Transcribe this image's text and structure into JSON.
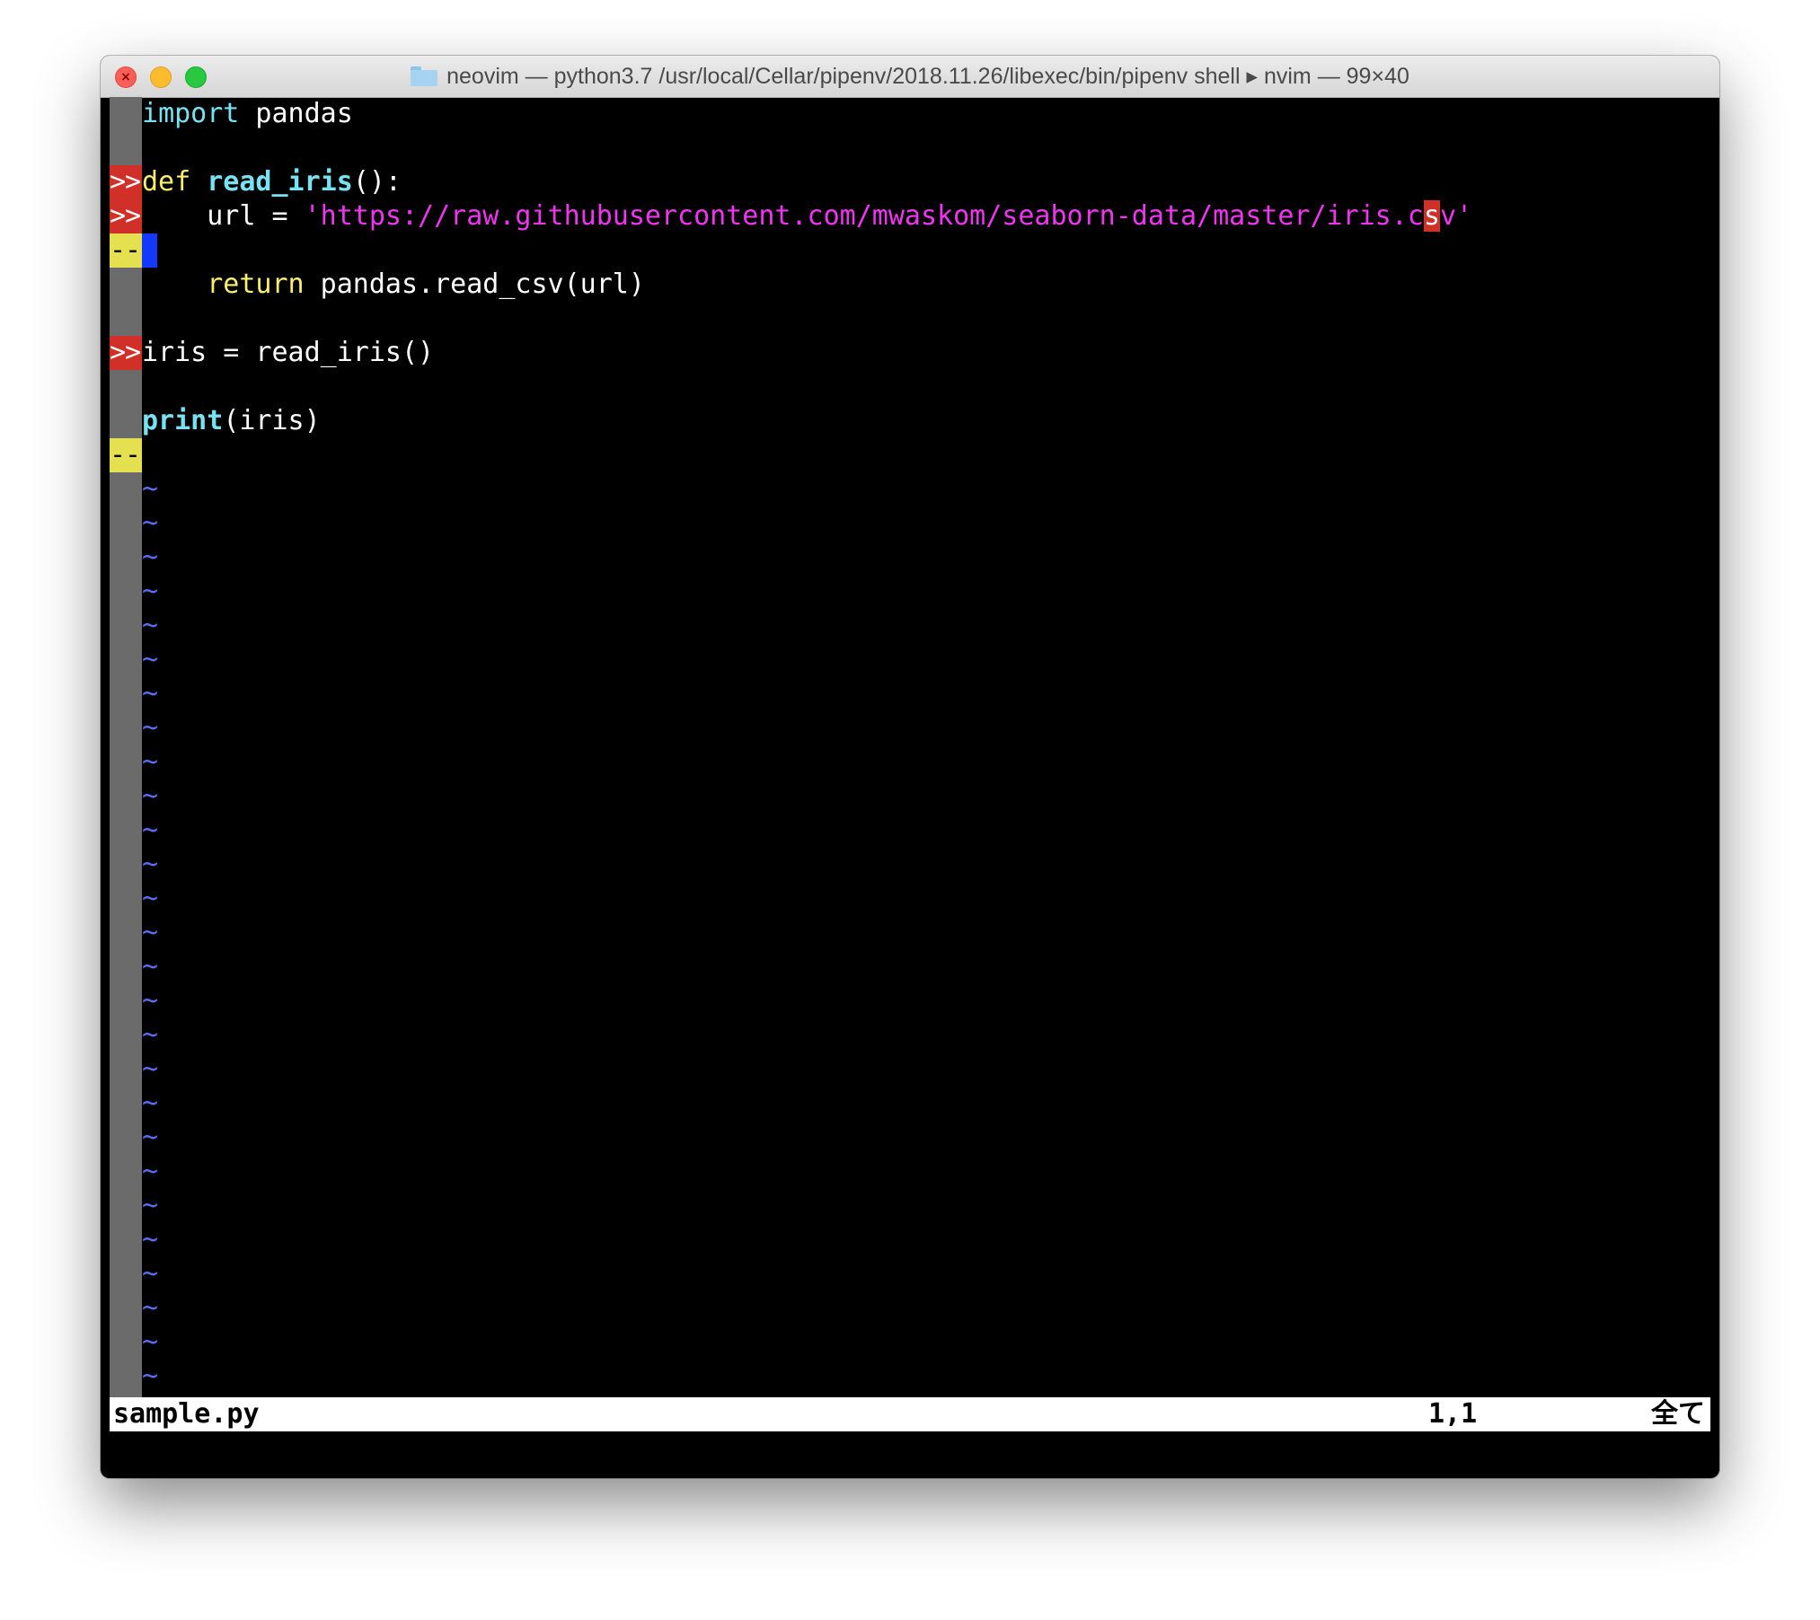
{
  "window": {
    "title": "neovim — python3.7 /usr/local/Cellar/pipenv/2018.11.26/libexec/bin/pipenv shell ▸ nvim — 99×40",
    "controls": {
      "close_glyph": "×"
    }
  },
  "editor": {
    "lines": [
      {
        "sign": "",
        "parts": [
          {
            "t": "i",
            "cls": "kw-import"
          },
          {
            "t": "mport",
            "cls": "kw-import"
          },
          {
            "t": " pandas",
            "cls": "text"
          }
        ]
      },
      {
        "sign": "",
        "parts": []
      },
      {
        "sign": ">>",
        "signType": "add",
        "parts": [
          {
            "t": "def",
            "cls": "kw-def"
          },
          {
            "t": " ",
            "cls": "text"
          },
          {
            "t": "read_iris",
            "cls": "fn-name"
          },
          {
            "t": "():",
            "cls": "text"
          }
        ]
      },
      {
        "sign": ">>",
        "signType": "add",
        "parts": [
          {
            "t": "    url = ",
            "cls": "text"
          },
          {
            "t": "'https://raw.githubusercontent.com/mwaskom/seaborn-data/master/iris.c",
            "cls": "str"
          },
          {
            "t": "s",
            "cls": "hl-red"
          },
          {
            "t": "v'",
            "cls": "str"
          }
        ]
      },
      {
        "sign": "--",
        "signType": "del",
        "parts": [],
        "cursor": true
      },
      {
        "sign": "",
        "parts": [
          {
            "t": "    ",
            "cls": "text"
          },
          {
            "t": "return",
            "cls": "kw-return"
          },
          {
            "t": " pandas.read_csv(url)",
            "cls": "text"
          }
        ]
      },
      {
        "sign": "",
        "parts": []
      },
      {
        "sign": ">>",
        "signType": "add",
        "parts": [
          {
            "t": "iris = read_iris()",
            "cls": "text"
          }
        ]
      },
      {
        "sign": "",
        "parts": []
      },
      {
        "sign": "",
        "parts": [
          {
            "t": "print",
            "cls": "builtin"
          },
          {
            "t": "(iris)",
            "cls": "text"
          }
        ]
      },
      {
        "sign": "--",
        "signType": "del",
        "parts": []
      }
    ],
    "tilde": "~",
    "tilde_count": 27
  },
  "statusline": {
    "filename": "sample.py",
    "position": "1,1",
    "percent": "全て"
  }
}
